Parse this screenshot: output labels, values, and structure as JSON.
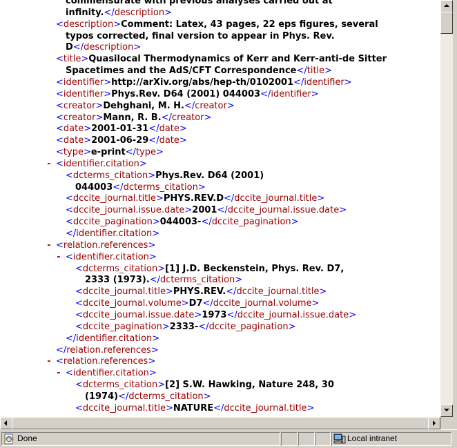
{
  "content_lines": [
    {
      "indent": 1,
      "marker": "",
      "tag": "",
      "text": "commensurate with previous analyses carried out at",
      "close": ""
    },
    {
      "indent": 1,
      "marker": "",
      "tag": "",
      "text": "infinity.",
      "close": "</description>"
    },
    {
      "indent": 0,
      "marker": "",
      "tag": "<description>",
      "text": "Comment: Latex, 43 pages, 22 eps figures, several",
      "close": ""
    },
    {
      "indent": 1,
      "marker": "",
      "tag": "",
      "text": "typos corrected, final version to appear in Phys. Rev.",
      "close": ""
    },
    {
      "indent": 1,
      "marker": "",
      "tag": "",
      "text": "D",
      "close": "</description>"
    },
    {
      "indent": 0,
      "marker": "",
      "tag": "<title>",
      "text": "Quasilocal Thermodynamics of Kerr and Kerr-anti-de Sitter",
      "close": ""
    },
    {
      "indent": 1,
      "marker": "",
      "tag": "",
      "text": "Spacetimes and the AdS/CFT Correspondence",
      "close": "</title>"
    },
    {
      "indent": 0,
      "marker": "",
      "tag": "<identifier>",
      "text": "http://arXiv.org/abs/hep-th/0102001",
      "close": "</identifier>"
    },
    {
      "indent": 0,
      "marker": "",
      "tag": "<identifier>",
      "text": "Phys.Rev. D64 (2001) 044003",
      "close": "</identifier>"
    },
    {
      "indent": 0,
      "marker": "",
      "tag": "<creator>",
      "text": "Dehghani, M. H.",
      "close": "</creator>"
    },
    {
      "indent": 0,
      "marker": "",
      "tag": "<creator>",
      "text": "Mann, R. B.",
      "close": "</creator>"
    },
    {
      "indent": 0,
      "marker": "",
      "tag": "<date>",
      "text": "2001-01-31",
      "close": "</date>"
    },
    {
      "indent": 0,
      "marker": "",
      "tag": "<date>",
      "text": "2001-06-29",
      "close": "</date>"
    },
    {
      "indent": 0,
      "marker": "",
      "tag": "<type>",
      "text": "e-print",
      "close": "</type>"
    },
    {
      "indent": 0,
      "marker": "-",
      "tag": "<identifier.citation>",
      "text": "",
      "close": ""
    },
    {
      "indent": 1,
      "marker": "",
      "tag": "<dcterms_citation>",
      "text": "Phys.Rev. D64 (2001)",
      "close": ""
    },
    {
      "indent": 2,
      "marker": "",
      "tag": "",
      "text": "044003",
      "close": "</dcterms_citation>"
    },
    {
      "indent": 1,
      "marker": "",
      "tag": "<dccite_journal.title>",
      "text": "PHYS.REV.D",
      "close": "</dccite_journal.title>"
    },
    {
      "indent": 1,
      "marker": "",
      "tag": "<dccite_journal.issue.date>",
      "text": "2001",
      "close": "</dccite_journal.issue.date>"
    },
    {
      "indent": 1,
      "marker": "",
      "tag": "<dccite_pagination>",
      "text": "044003-",
      "close": "</dccite_pagination>"
    },
    {
      "indent": 1,
      "marker": "",
      "tag": "",
      "text": "",
      "close": "</identifier.citation>"
    },
    {
      "indent": 0,
      "marker": "-",
      "tag": "<relation.references>",
      "text": "",
      "close": ""
    },
    {
      "indent": 1,
      "marker": "-",
      "tag": "<identifier.citation>",
      "text": "",
      "close": ""
    },
    {
      "indent": 2,
      "marker": "",
      "tag": "<dcterms_citation>",
      "text": "[1] J.D. Beckenstein, Phys. Rev. D7,",
      "close": ""
    },
    {
      "indent": 3,
      "marker": "",
      "tag": "",
      "text": "2333 (1973).",
      "close": "</dcterms_citation>"
    },
    {
      "indent": 2,
      "marker": "",
      "tag": "<dccite_journal.title>",
      "text": "PHYS.REV.",
      "close": "</dccite_journal.title>"
    },
    {
      "indent": 2,
      "marker": "",
      "tag": "<dccite_journal.volume>",
      "text": "D7",
      "close": "</dccite_journal.volume>"
    },
    {
      "indent": 2,
      "marker": "",
      "tag": "<dccite_journal.issue.date>",
      "text": "1973",
      "close": "</dccite_journal.issue.date>"
    },
    {
      "indent": 2,
      "marker": "",
      "tag": "<dccite_pagination>",
      "text": "2333-",
      "close": "</dccite_pagination>"
    },
    {
      "indent": 1,
      "marker": "",
      "tag": "",
      "text": "",
      "close": "</identifier.citation>"
    },
    {
      "indent": 0,
      "marker": "",
      "tag": "",
      "text": "",
      "close": "</relation.references>"
    },
    {
      "indent": 0,
      "marker": "-",
      "tag": "<relation.references>",
      "text": "",
      "close": ""
    },
    {
      "indent": 1,
      "marker": "-",
      "tag": "<identifier.citation>",
      "text": "",
      "close": ""
    },
    {
      "indent": 2,
      "marker": "",
      "tag": "<dcterms_citation>",
      "text": "[2] S.W. Hawking, Nature 248, 30",
      "close": ""
    },
    {
      "indent": 3,
      "marker": "",
      "tag": "",
      "text": "(1974)",
      "close": "</dcterms_citation>"
    },
    {
      "indent": 2,
      "marker": "",
      "tag": "<dccite_journal.title>",
      "text": "NATURE",
      "close": "</dccite_journal.title>"
    }
  ],
  "status": {
    "text": "Done",
    "zone": "Local intranet",
    "page_icon": "ie-page-icon",
    "zone_icon": "intranet-computer-icon"
  },
  "colors": {
    "markup": "#0000ff",
    "tag_name": "#990000",
    "collapse_marker": "#c00000",
    "background": "#ffffff",
    "chrome": "#d4d0c8"
  }
}
